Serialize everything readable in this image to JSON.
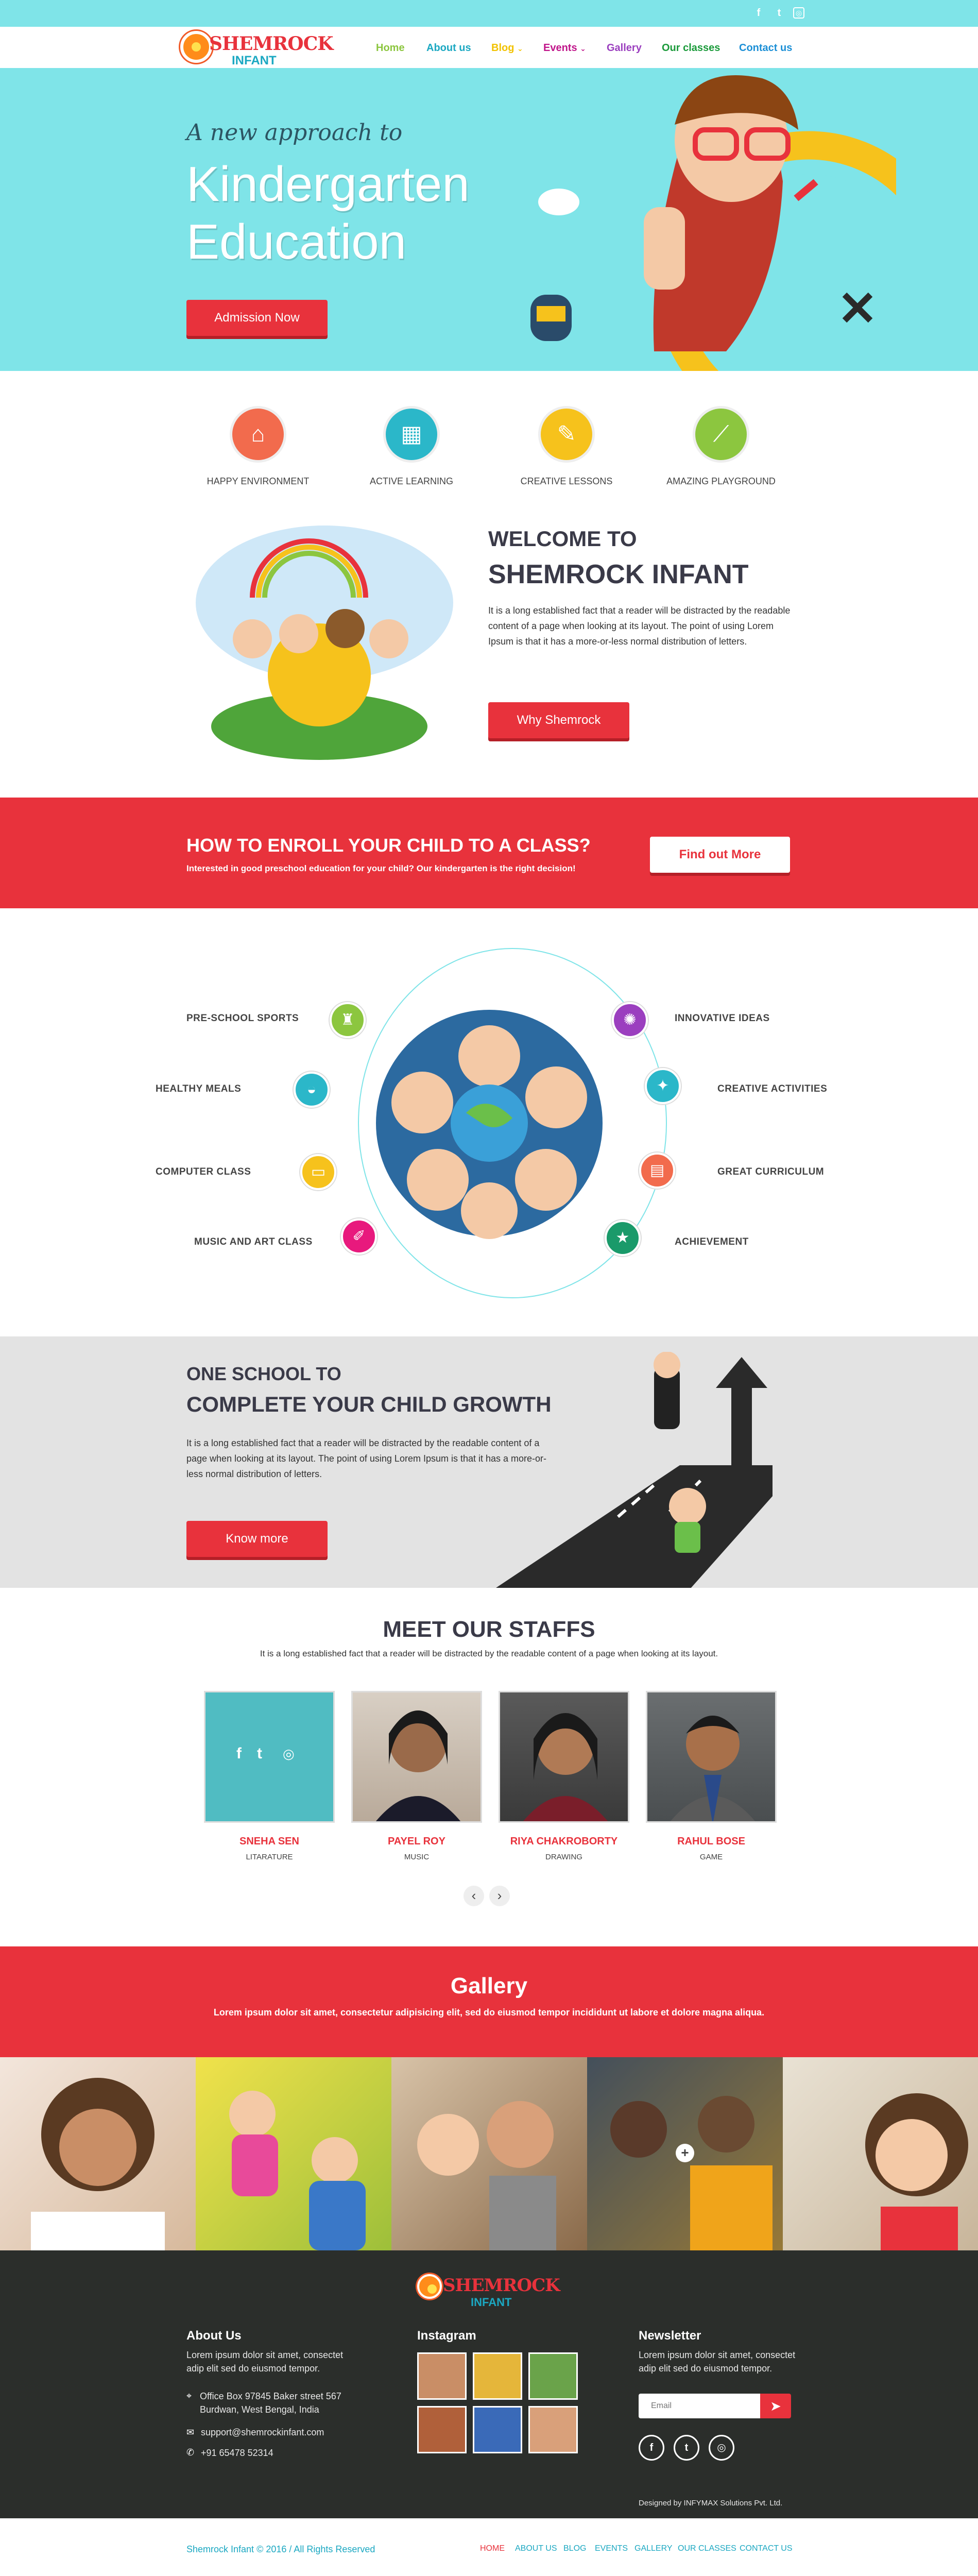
{
  "colors": {
    "accent_red": "#e8323c",
    "accent_cyan": "#7fe4e8",
    "teal": "#1ba8c2",
    "dark_footer": "#2b2e2b"
  },
  "topbar": {
    "social_icons": [
      "facebook-icon",
      "twitter-icon",
      "instagram-icon"
    ]
  },
  "brand": {
    "name": "SHEMROCK",
    "sub": "INFANT"
  },
  "nav": {
    "items": [
      {
        "label": "Home",
        "color": "#8cc63f"
      },
      {
        "label": "About us",
        "color": "#1ba8c2"
      },
      {
        "label": "Blog",
        "color": "#f2c200",
        "caret": "⌄"
      },
      {
        "label": "Events",
        "color": "#c0158a",
        "caret": "⌄"
      },
      {
        "label": "Gallery",
        "color": "#9b3fbf"
      },
      {
        "label": "Our classes",
        "color": "#1a9a3a"
      },
      {
        "label": "Contact us",
        "color": "#1b8fd6"
      }
    ]
  },
  "hero": {
    "tagline": "A new approach to",
    "title": "Kindergarten Education",
    "cta": "Admission Now"
  },
  "features": [
    {
      "label": "HAPPY ENVIRONMENT",
      "icon": "school-icon",
      "color": "#f26b4d"
    },
    {
      "label": "ACTIVE LEARNING",
      "icon": "abc-blocks-icon",
      "color": "#2bb7c9"
    },
    {
      "label": "CREATIVE LESSONS",
      "icon": "palette-icon",
      "color": "#f6c21c"
    },
    {
      "label": "AMAZING PLAYGROUND",
      "icon": "slide-icon",
      "color": "#8cc63f"
    }
  ],
  "welcome": {
    "line1": "WELCOME TO",
    "line2": "SHEMROCK INFANT",
    "text": "It is a long established fact that a reader will be distracted by the readable content of a page when looking at its layout. The point of using Lorem Ipsum is that it has a more-or-less normal distribution of letters.",
    "cta": "Why Shemrock"
  },
  "enroll": {
    "title": "HOW TO ENROLL YOUR CHILD TO A CLASS?",
    "text": "Interested in good preschool education for your child? Our kindergarten is the right decision!",
    "cta": "Find out More"
  },
  "programs": {
    "left": [
      {
        "label": "PRE-SCHOOL SPORTS",
        "icon": "trophy-icon",
        "color": "#8cc63f"
      },
      {
        "label": "HEALTHY MEALS",
        "icon": "meal-icon",
        "color": "#2bb7c9"
      },
      {
        "label": "COMPUTER CLASS",
        "icon": "monitor-icon",
        "color": "#f6c21c"
      },
      {
        "label": "MUSIC AND ART CLASS",
        "icon": "art-icon",
        "color": "#e8197d"
      }
    ],
    "right": [
      {
        "label": "INNOVATIVE IDEAS",
        "icon": "brain-icon",
        "color": "#9b3fbf"
      },
      {
        "label": "CREATIVE ACTIVITIES",
        "icon": "lightbulb-icon",
        "color": "#2bb7c9"
      },
      {
        "label": "GREAT CURRICULUM",
        "icon": "book-icon",
        "color": "#f26b4d"
      },
      {
        "label": "ACHIEVEMENT",
        "icon": "medal-icon",
        "color": "#1a9a6a"
      }
    ]
  },
  "growth": {
    "line1": "ONE SCHOOL TO",
    "line2": "COMPLETE YOUR CHILD GROWTH",
    "text": "It is a long established fact that a reader will be distracted by the readable content of a page when looking at its layout. The point of using Lorem Ipsum is that it has a more-or-less normal distribution of letters.",
    "cta": "Know more"
  },
  "staff": {
    "title": "MEET OUR STAFFS",
    "subtitle": "It is a long established fact that a reader will be distracted by the readable content of a page when looking at its layout.",
    "members": [
      {
        "name": "SNEHA SEN",
        "role": "LITARATURE"
      },
      {
        "name": "PAYEL ROY",
        "role": "MUSIC"
      },
      {
        "name": "RIYA CHAKROBORTY",
        "role": "DRAWING"
      },
      {
        "name": "RAHUL BOSE",
        "role": "GAME"
      }
    ],
    "prev": "‹",
    "next": "›"
  },
  "gallery": {
    "title": "Gallery",
    "subtitle": "Lorem ipsum dolor sit amet, consectetur adipisicing elit, sed do eiusmod tempor incididunt ut labore et dolore magna aliqua.",
    "zoom": "+"
  },
  "footer": {
    "about_title": "About Us",
    "about_text": "Lorem ipsum dolor sit amet, consectet adip elit sed do eiusmod tempor.",
    "address": "Office Box 97845 Baker street 567 Burdwan, West Bengal, India",
    "email": "support@shemrockinfant.com",
    "phone": "+91 65478 52314",
    "instagram_title": "Instagram",
    "newsletter_title": "Newsletter",
    "newsletter_text": "Lorem ipsum dolor sit amet, consectet adip elit sed do eiusmod tempor.",
    "email_placeholder": "Email",
    "credit": "Designed by INFYMAX Solutions Pvt. Ltd."
  },
  "bottom": {
    "copyright": "Shemrock Infant © 2016 / All Rights Reserved",
    "nav": [
      "HOME",
      "ABOUT US",
      "BLOG",
      "EVENTS",
      "GALLERY",
      "OUR CLASSES",
      "CONTACT US"
    ]
  }
}
